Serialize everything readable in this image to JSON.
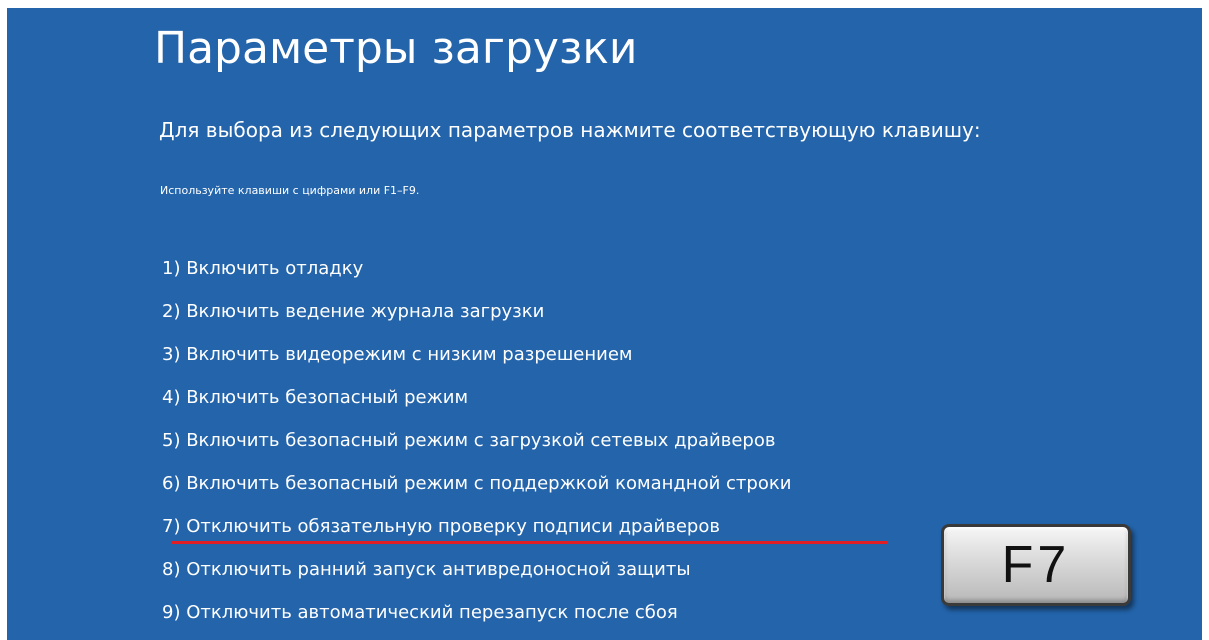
{
  "screen": {
    "background_color": "#2364ab",
    "title": "Параметры загрузки",
    "instruction": "Для выбора из следующих параметров нажмите соответствующую клавишу:",
    "hint": "Используйте клавиши с цифрами или F1–F9."
  },
  "options": [
    {
      "label": "1) Включить отладку"
    },
    {
      "label": "2) Включить ведение журнала загрузки"
    },
    {
      "label": "3) Включить видеорежим с низким разрешением"
    },
    {
      "label": "4) Включить безопасный режим"
    },
    {
      "label": "5) Включить безопасный режим с загрузкой сетевых драйверов"
    },
    {
      "label": "6) Включить безопасный режим с поддержкой командной строки"
    },
    {
      "label": "7) Отключить обязательную проверку подписи драйверов"
    },
    {
      "label": "8) Отключить ранний запуск антивредоносной защиты"
    },
    {
      "label": "9) Отключить автоматический перезапуск после сбоя"
    }
  ],
  "annotation": {
    "highlighted_option": 7,
    "underline_color": "#e01e24",
    "key_label": "F7"
  }
}
